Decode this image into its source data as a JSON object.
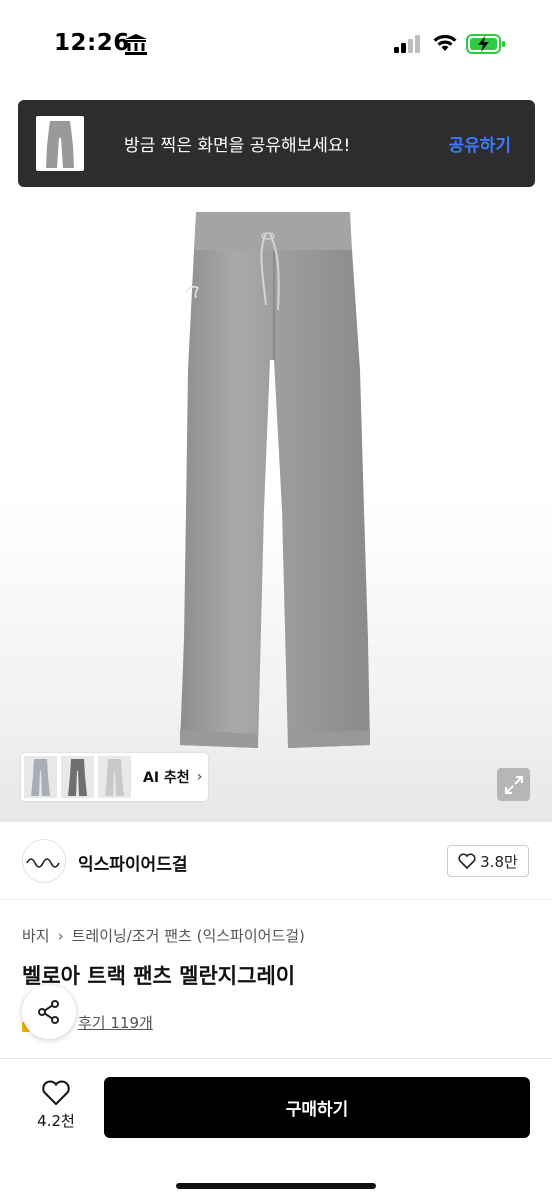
{
  "status_bar": {
    "time": "12:26"
  },
  "toast": {
    "message": "방금 찍은 화면을 공유해보세요!",
    "action": "공유하기"
  },
  "gallery": {
    "ai_label": "AI 추천"
  },
  "brand": {
    "name": "익스파이어드걸",
    "like_count": "3.8만"
  },
  "breadcrumb": {
    "category": "바지",
    "subcategory": "트레이닝/조거 팬츠 (익스파이어드걸)"
  },
  "product": {
    "title": "벨로아 트랙 팬츠 멜란지그레이",
    "review_label": "후기 119개"
  },
  "bottom_bar": {
    "wish_count": "4.2천",
    "buy_label": "구매하기"
  },
  "colors": {
    "toast_bg": "#2d2d2f",
    "toast_action": "#3a7bff",
    "buy_bg": "#000000",
    "battery": "#2ecc40"
  }
}
